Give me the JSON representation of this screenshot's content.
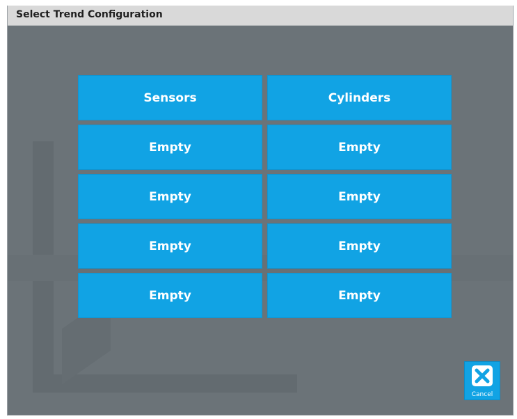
{
  "dialog": {
    "title": "Select Trend Configuration"
  },
  "tiles": [
    {
      "label": "Sensors"
    },
    {
      "label": "Cylinders"
    },
    {
      "label": "Empty"
    },
    {
      "label": "Empty"
    },
    {
      "label": "Empty"
    },
    {
      "label": "Empty"
    },
    {
      "label": "Empty"
    },
    {
      "label": "Empty"
    },
    {
      "label": "Empty"
    },
    {
      "label": "Empty"
    }
  ],
  "cancel": {
    "label": "Cancel",
    "icon": "close-x-icon"
  },
  "colors": {
    "tile": "#11a3e4",
    "overlay": "#6b7378",
    "titlebar": "#d9d9d9"
  }
}
